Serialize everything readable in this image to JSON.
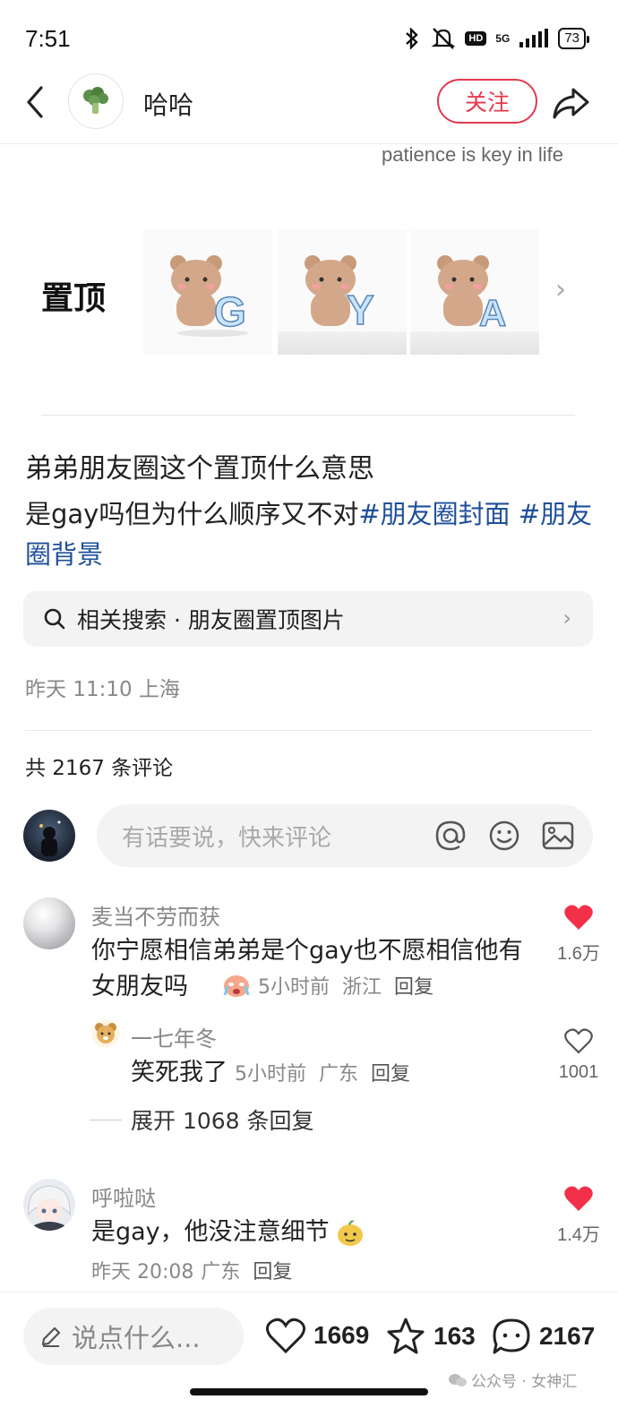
{
  "status_bar": {
    "time": "7:51",
    "network": "5G",
    "battery": "73",
    "hd": "HD"
  },
  "header": {
    "author_name": "哈哈",
    "follow_label": "关注",
    "avatar_icon": "broccoli-icon"
  },
  "pinned": {
    "caption": "patience is key in life",
    "label": "置顶",
    "tiles": [
      "G",
      "Y",
      "A"
    ]
  },
  "post": {
    "title": "弟弟朋友圈这个置顶什么意思",
    "body_prefix": "是gay吗但为什么顺序又不对",
    "hashtag1": "#朋友圈封面",
    "hashtag2": "#朋友圈背景",
    "meta": "昨天 11:10 上海"
  },
  "related": {
    "label": "相关搜索 · 朋友圈置顶图片"
  },
  "comments_header": {
    "count_text": "共 2167 条评论",
    "input_placeholder": "有话要说，快来评论"
  },
  "comments": [
    {
      "name": "麦当不劳而获",
      "text": "你宁愿相信弟弟是个gay也不愿相信他有女朋友吗",
      "time": "5小时前",
      "location": "浙江",
      "reply": "回复",
      "likes": "1.6万",
      "liked": true
    },
    {
      "name": "一七年冬",
      "text": "笑死我了",
      "time": "5小时前",
      "location": "广东",
      "reply": "回复",
      "likes": "1001",
      "liked": false
    },
    {
      "name": "呼啦哒",
      "text": "是gay，他没注意细节",
      "time": "昨天 20:08",
      "location": "广东",
      "reply": "回复",
      "likes": "1.4万",
      "liked": true
    }
  ],
  "expand_replies": "展开 1068 条回复",
  "bottom_bar": {
    "say_placeholder": "说点什么...",
    "likes": "1669",
    "stars": "163",
    "comments": "2167"
  },
  "watermark": "公众号 · 女神汇",
  "colors": {
    "accent_red": "#e33a4e",
    "like_red": "#f2304a",
    "hashtag_blue": "#1f4f9a"
  }
}
